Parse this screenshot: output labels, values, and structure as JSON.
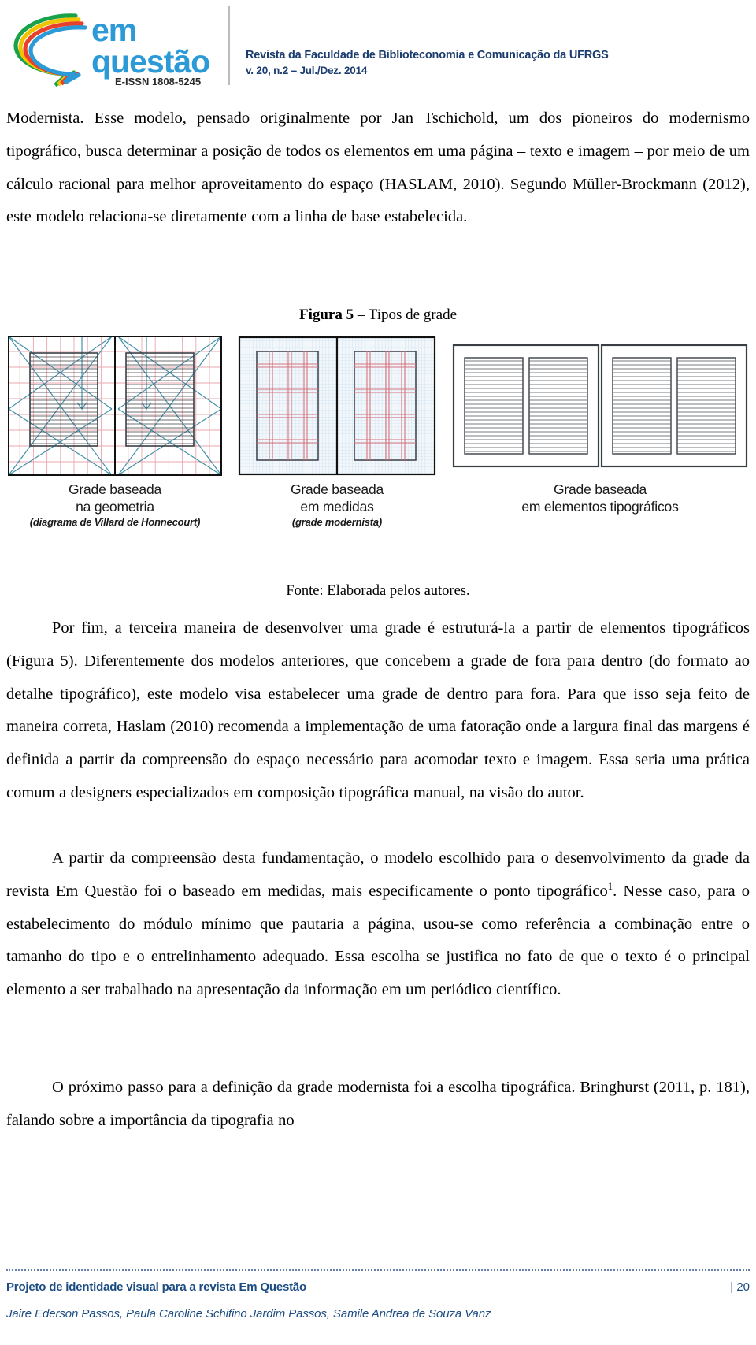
{
  "header": {
    "journal_line1": "Revista da Faculdade de Biblioteconomia e Comunicação da UFRGS",
    "journal_line2": "v. 20, n.2 – Jul./Dez. 2014",
    "logo_word1": "em",
    "logo_word2": "questão",
    "logo_issn": "E-ISSN 1808-5245",
    "accent_blue": "#1b3c6e",
    "logo_blue": "#2b9ad6"
  },
  "body": {
    "paragraph_1": "Modernista. Esse modelo, pensado originalmente por Jan Tschichold, um dos pioneiros do modernismo tipográfico, busca determinar a posição de todos os elementos em uma página – texto e imagem – por meio de um cálculo racional para melhor aproveitamento do espaço (HASLAM, 2010). Segundo Müller-Brockmann (2012), este modelo relaciona-se diretamente com a linha de base estabelecida.",
    "paragraph_2_a": "Por fim, a terceira maneira de desenvolver uma grade é estruturá-la a partir de elementos tipográficos (Figura 5). Diferentemente dos modelos anteriores, que concebem a grade de fora para dentro (do formato ao detalhe tipográfico), este modelo visa estabelecer uma grade de dentro para fora. Para que isso seja feito de maneira correta, Haslam (2010) recomenda a implementação de uma fatoração onde a largura final das margens é definida a partir da compreensão do espaço necessário para acomodar texto e imagem. Essa seria uma prática comum a designers especializados em composição tipográfica manual, na visão do autor.",
    "paragraph_3_a": "A partir da compreensão desta fundamentação, o modelo escolhido para o desenvolvimento da grade da revista Em Questão foi o baseado em medidas, mais especificamente o ponto tipográfico",
    "paragraph_3_footnote": "1",
    "paragraph_3_b": ". Nesse caso, para o estabelecimento do módulo mínimo que pautaria a página, usou-se como referência a combinação entre o tamanho do tipo e o entrelinhamento adequado. Essa escolha se justifica no fato de que o texto é o principal elemento a ser trabalhado na apresentação da informação em um periódico científico.",
    "paragraph_4": "O próximo passo para a definição da grade modernista foi a escolha tipográfica. Bringhurst (2011, p. 181), falando sobre a importância da tipografia no"
  },
  "figure": {
    "caption_bold": "Figura 5",
    "caption_rest": " – Tipos de grade",
    "source": "Fonte: Elaborada pelos autores.",
    "panels": [
      {
        "title_line1": "Grade baseada",
        "title_line2": "na geometria",
        "subtitle": "(diagrama de Villard de Honnecourt)",
        "kind": "geometry"
      },
      {
        "title_line1": "Grade baseada",
        "title_line2": "em medidas",
        "subtitle": "(grade modernista)",
        "kind": "measures"
      },
      {
        "title_line1": "Grade baseada",
        "title_line2": "em elementos tipográficos",
        "subtitle": "",
        "kind": "typographic"
      }
    ]
  },
  "footer": {
    "title": "Projeto de identidade visual para a revista Em Questão",
    "page_number": "| 20",
    "authors": "Jaire Ederson Passos, Paula Caroline Schifino Jardim Passos,  Samile Andrea de Souza Vanz",
    "color": "#1b4c82"
  }
}
